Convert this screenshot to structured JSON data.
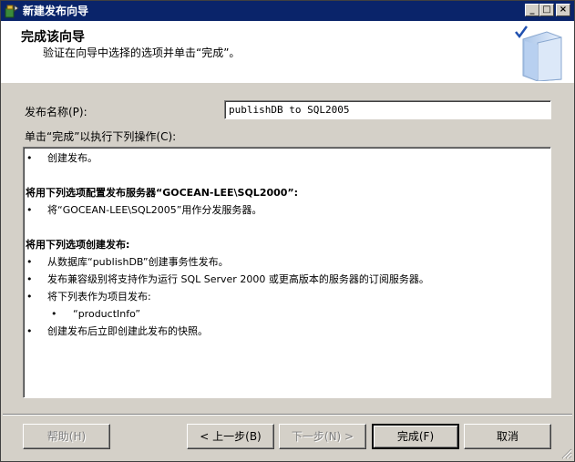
{
  "window": {
    "title": "新建发布向导"
  },
  "header": {
    "title": "完成该向导",
    "subtitle": "验证在向导中选择的选项并单击“完成”。",
    "icon": "wizard-book-check-icon"
  },
  "publication_name": {
    "label": "发布名称(P):",
    "value": "publishDB to SQL2005"
  },
  "summary": {
    "label": "单击“完成”以执行下列操作(C):",
    "lines": [
      {
        "type": "bullet",
        "text": "创建发布。"
      },
      {
        "type": "blank",
        "text": ""
      },
      {
        "type": "heading",
        "text": "将用下列选项配置发布服务器“GOCEAN-LEE\\SQL2000”:"
      },
      {
        "type": "bullet",
        "text": "将“GOCEAN-LEE\\SQL2005”用作分发服务器。"
      },
      {
        "type": "blank",
        "text": ""
      },
      {
        "type": "heading",
        "text": "将用下列选项创建发布:"
      },
      {
        "type": "bullet",
        "text": "从数据库“publishDB”创建事务性发布。"
      },
      {
        "type": "bullet",
        "text": "发布兼容级别将支持作为运行 SQL Server 2000 或更高版本的服务器的订阅服务器。"
      },
      {
        "type": "bullet",
        "text": "将下列表作为项目发布:"
      },
      {
        "type": "subbullet",
        "text": "“productInfo”"
      },
      {
        "type": "bullet",
        "text": "创建发布后立即创建此发布的快照。"
      }
    ]
  },
  "buttons": {
    "help": "帮助(H)",
    "back": "< 上一步(B)",
    "next": "下一步(N) >",
    "finish": "完成(F)",
    "cancel": "取消"
  }
}
